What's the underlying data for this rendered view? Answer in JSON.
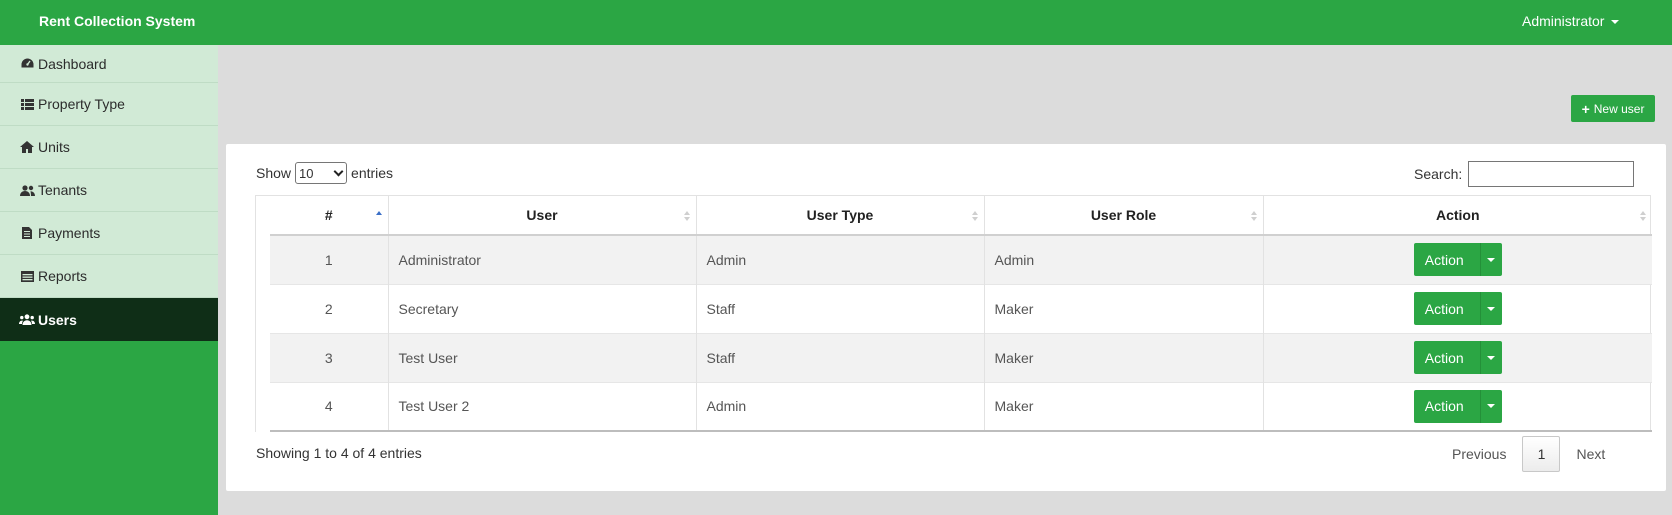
{
  "header": {
    "brand": "Rent Collection System",
    "user_menu": "Administrator"
  },
  "sidebar": {
    "items": [
      {
        "label": "Dashboard",
        "icon": "dashboard-icon"
      },
      {
        "label": "Property Type",
        "icon": "list-icon"
      },
      {
        "label": "Units",
        "icon": "home-icon"
      },
      {
        "label": "Tenants",
        "icon": "users-icon"
      },
      {
        "label": "Payments",
        "icon": "document-icon"
      },
      {
        "label": "Reports",
        "icon": "table-icon"
      },
      {
        "label": "Users",
        "icon": "group-icon",
        "active": true
      }
    ]
  },
  "toolbar": {
    "new_user_label": "New user"
  },
  "table_controls": {
    "show_label": "Show",
    "page_length": "10",
    "entries_label": "entries",
    "search_label": "Search:",
    "search_value": ""
  },
  "table": {
    "columns": [
      "#",
      "User",
      "User Type",
      "User Role",
      "Action"
    ],
    "rows": [
      {
        "num": "1",
        "user": "Administrator",
        "type": "Admin",
        "role": "Admin",
        "action": "Action"
      },
      {
        "num": "2",
        "user": "Secretary",
        "type": "Staff",
        "role": "Maker",
        "action": "Action"
      },
      {
        "num": "3",
        "user": "Test User",
        "type": "Staff",
        "role": "Maker",
        "action": "Action"
      },
      {
        "num": "4",
        "user": "Test User 2",
        "type": "Admin",
        "role": "Maker",
        "action": "Action"
      }
    ]
  },
  "footer": {
    "info": "Showing 1 to 4 of 4 entries",
    "previous": "Previous",
    "page": "1",
    "next": "Next"
  },
  "colors": {
    "brand_green": "#2ba644",
    "active_nav": "#0f2e17",
    "sidebar_item_bg": "#d1ead6"
  }
}
